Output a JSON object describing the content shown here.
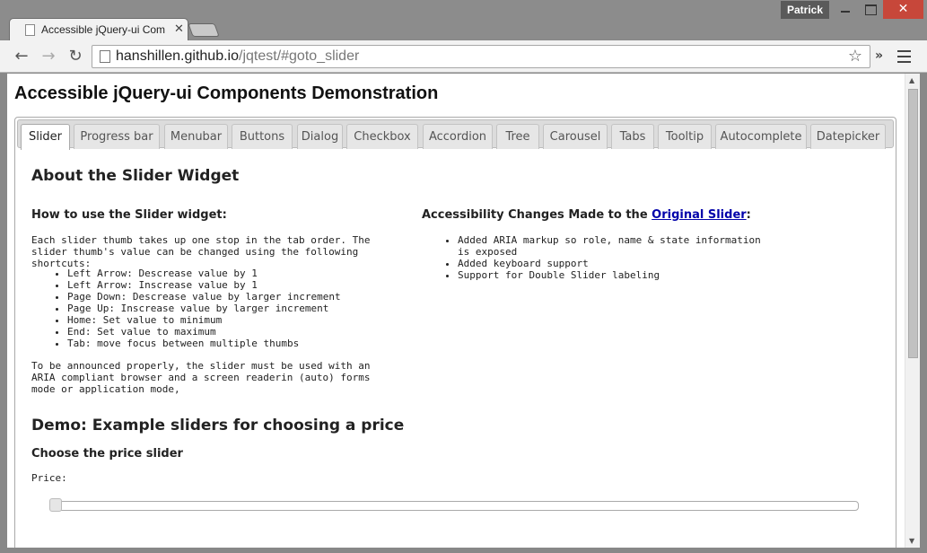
{
  "browser": {
    "user_name": "Patrick",
    "tab_title": "Accessible jQuery-ui Components Demonstration",
    "url_host": "hanshillen.github.io",
    "url_path": "/jqtest/#goto_slider",
    "ext_chevron": "»"
  },
  "page": {
    "heading": "Accessible jQuery-ui Components Demonstration",
    "tabs": [
      {
        "label": "Slider",
        "selected": true
      },
      {
        "label": "Progress bar"
      },
      {
        "label": "Menubar"
      },
      {
        "label": "Buttons"
      },
      {
        "label": "Dialog"
      },
      {
        "label": "Checkbox"
      },
      {
        "label": "Accordion"
      },
      {
        "label": "Tree"
      },
      {
        "label": "Carousel"
      },
      {
        "label": "Tabs"
      },
      {
        "label": "Tooltip"
      },
      {
        "label": "Autocomplete"
      },
      {
        "label": "Datepicker"
      }
    ]
  },
  "panel": {
    "about_title": "About the Slider Widget",
    "howto_title": "How to use the Slider widget:",
    "intro": "Each slider thumb takes up one stop in the tab order. The slider thumb's value can be changed using the following shortcuts:",
    "shortcuts": [
      "Left Arrow: Descrease value by 1",
      "Left Arrow: Inscrease value by 1",
      "Page Down: Descrease value by larger increment",
      "Page Up: Inscrease value by larger increment",
      "Home: Set value to minimum",
      "End: Set value to maximum",
      "Tab: move focus between multiple thumbs"
    ],
    "announce": "To be announced properly, the slider must be used with an ARIA compliant browser and a screen readerin (auto) forms mode or application mode,",
    "access_title_prefix": "Accessibility Changes Made to the ",
    "access_link": "Original Slider",
    "access_title_suffix": ":",
    "access_changes": [
      "Added ARIA markup so role, name & state information is exposed",
      "Added keyboard support",
      "Support for Double Slider labeling"
    ],
    "demo_title": "Demo: Example sliders for choosing a price",
    "choose_title": "Choose the price slider",
    "price_label": "Price:",
    "slider_value_fraction": 0
  }
}
